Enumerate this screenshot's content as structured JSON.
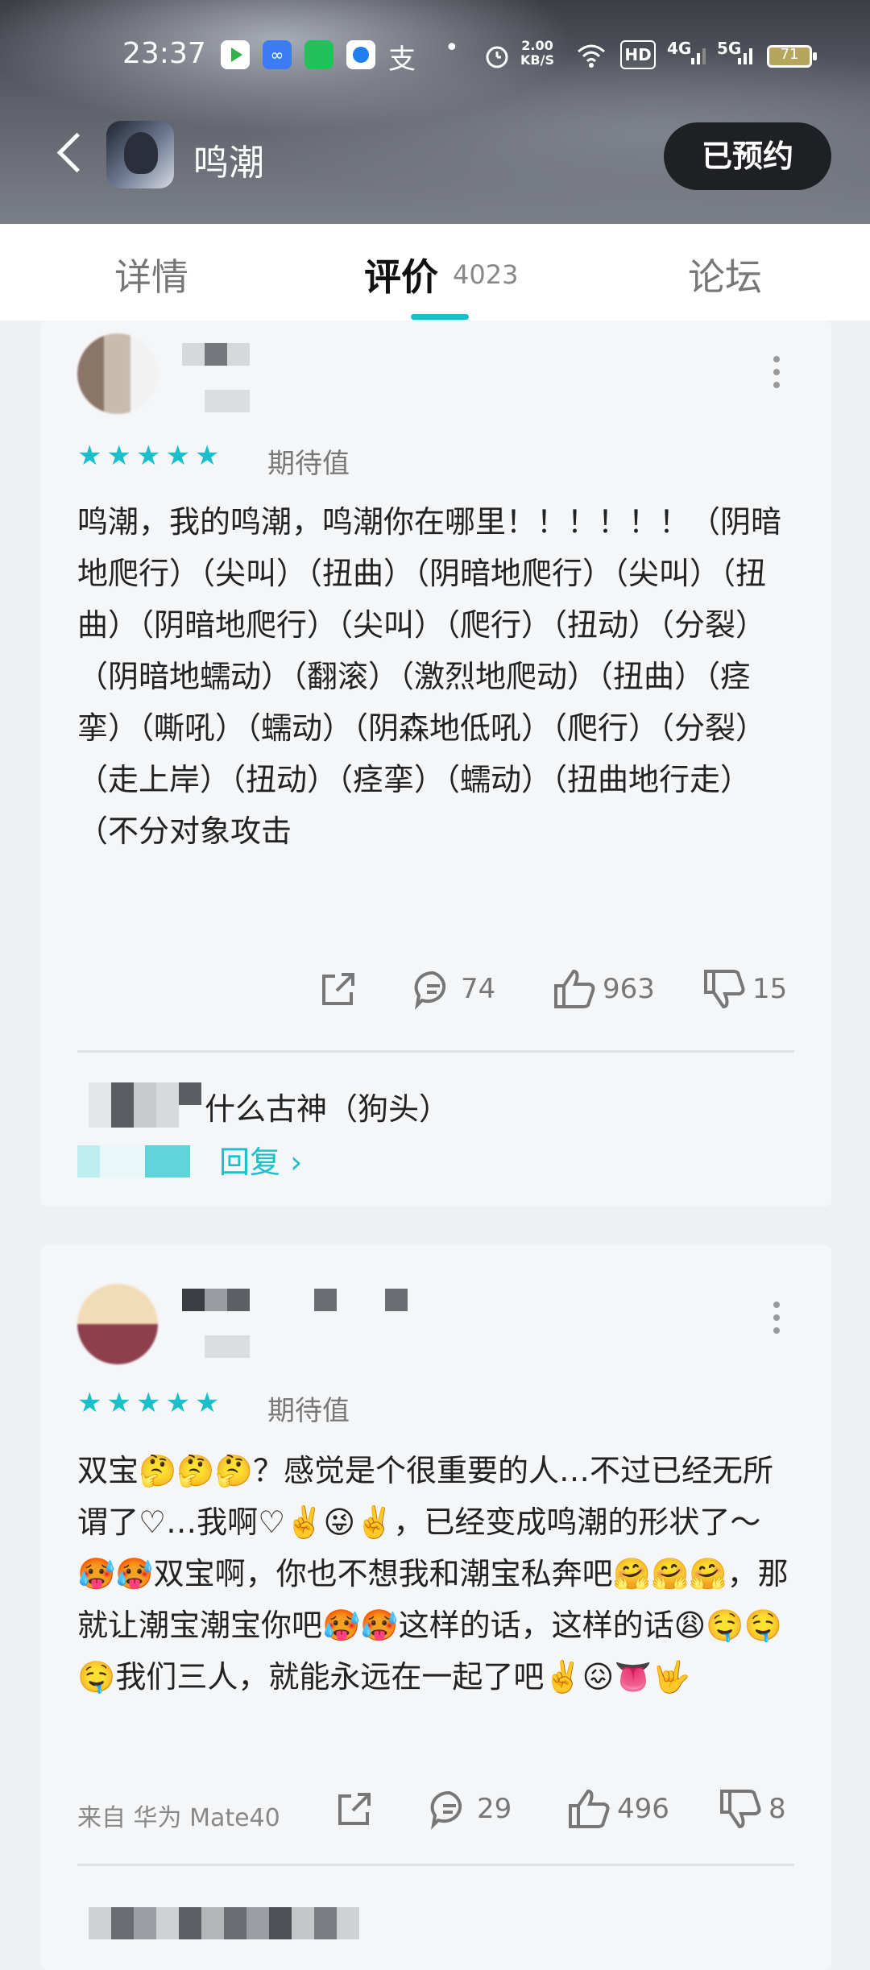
{
  "status_bar": {
    "time": "23:37",
    "net_speed": "2.00",
    "net_speed_unit": "KB/S",
    "battery": "71",
    "hd": "HD",
    "net1": "4G",
    "net2": "5G",
    "icons": [
      "app-icon-green-play",
      "app-icon-blue-infinity",
      "app-icon-green-square",
      "app-icon-blue-circle",
      "alipay-icon",
      "dot-icon",
      "alarm-icon",
      "wifi-icon",
      "signal-icon",
      "battery-icon"
    ]
  },
  "header": {
    "app_name": "鸣潮",
    "reserve_button": "已预约"
  },
  "tabs": {
    "details": "详情",
    "reviews": "评价",
    "reviews_count": "4023",
    "forum": "论坛"
  },
  "reviews": [
    {
      "rating_label": "期待值",
      "stars": "★★★★★",
      "content": "鸣潮，我的鸣潮，鸣潮你在哪里！！！！！！（阴暗地爬行）（尖叫）（扭曲）（阴暗地爬行）（尖叫）（扭曲）（阴暗地爬行）（尖叫）（爬行）（扭动）（分裂）（阴暗地蠕动）（翻滚）（激烈地爬动）（扭曲）（痉挛）（嘶吼）（蠕动）（阴森地低吼）（爬行）（分裂）（走上岸）（扭动）（痉挛）（蠕动）（扭曲地行走）（不分对象攻击",
      "comments": "74",
      "likes": "963",
      "dislikes": "15",
      "reply_preview": "什么古神（狗头）",
      "reply_link": "回复 ›"
    },
    {
      "rating_label": "期待值",
      "stars": "★★★★★",
      "content": "双宝🤔🤔🤔？感觉是个很重要的人…不过已经无所谓了♡…我啊♡✌️😜✌️，已经变成鸣潮的形状了～🥵🥵双宝啊，你也不想我和潮宝私奔吧🤗🤗🤗，那就让潮宝潮宝你吧🥵🥵这样的话，这样的话😩🤤🤤🤤我们三人，就能永远在一起了吧✌️😖👅🤟",
      "source": "来自 华为 Mate40",
      "comments": "29",
      "likes": "496",
      "dislikes": "8"
    }
  ],
  "colors": {
    "accent": "#19bfc9",
    "header_dark": "#3b3e45",
    "card_bg": "#f5f6f8",
    "reserve_button_bg": "#1f2024"
  }
}
